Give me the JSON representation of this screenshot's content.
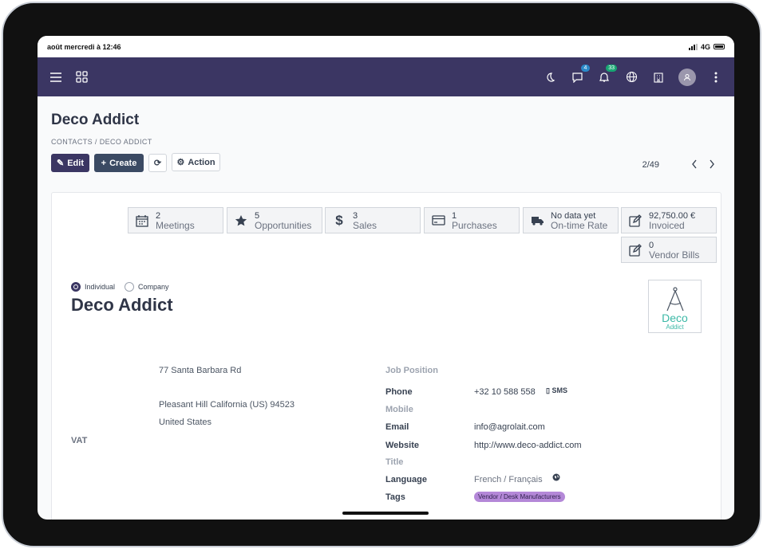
{
  "status_bar": {
    "datetime": "août mercredi à 12:46",
    "network": "4G"
  },
  "navbar": {
    "chat_badge": "4",
    "notif_badge": "33"
  },
  "control": {
    "page_title": "Deco Addict",
    "breadcrumb": "CONTACTS  /  DECO ADDICT",
    "edit_label": "Edit",
    "create_label": "Create",
    "action_label": "Action",
    "pager": "2/49"
  },
  "stats": [
    {
      "value": "2",
      "label": "Meetings",
      "icon": "calendar-icon"
    },
    {
      "value": "5",
      "label": "Opportunities",
      "icon": "star-icon"
    },
    {
      "value": "3",
      "label": "Sales",
      "icon": "dollar-icon"
    },
    {
      "value": "1",
      "label": "Purchases",
      "icon": "credit-card-icon"
    },
    {
      "value": "No data yet",
      "label": "On-time Rate",
      "icon": "truck-icon"
    },
    {
      "value": "92,750.00 €",
      "label": "Invoiced",
      "icon": "edit-icon"
    },
    {
      "value": "0",
      "label": "Vendor Bills",
      "icon": "edit-icon"
    }
  ],
  "form": {
    "radio_individual": "Individual",
    "radio_company": "Company",
    "name": "Deco Addict",
    "logo_line1": "Deco",
    "logo_line2": "Addict",
    "address_street": "77 Santa Barbara Rd",
    "address_city": "Pleasant Hill  California (US)  94523",
    "address_country": "United States",
    "vat_label": "VAT",
    "job_position_label": "Job Position",
    "phone_label": "Phone",
    "phone_value": "+32 10 588 558",
    "sms_label": "SMS",
    "mobile_label": "Mobile",
    "email_label": "Email",
    "email_value": "info@agrolait.com",
    "website_label": "Website",
    "website_value": "http://www.deco-addict.com",
    "title_label": "Title",
    "language_label": "Language",
    "language_value": "French / Français",
    "tags_label": "Tags",
    "tag_value": "Vendor / Desk Manufacturers"
  },
  "colors": {
    "navbar": "#3b3663",
    "primary": "#3b3663",
    "tag": "#b488d8",
    "accent": "#3bb8a6"
  }
}
